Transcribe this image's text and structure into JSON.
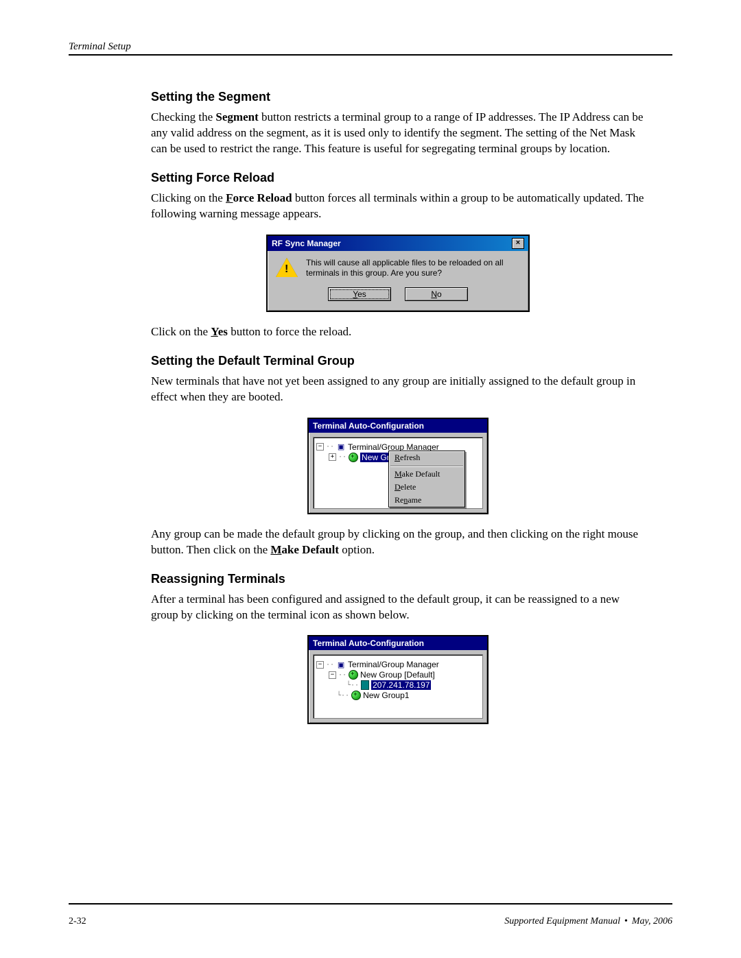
{
  "header": {
    "section": "Terminal Setup"
  },
  "sections": {
    "segment": {
      "heading": "Setting the Segment",
      "para1_a": "Checking the ",
      "para1_bold": "Segment",
      "para1_b": " button restricts a terminal group to a range of IP addresses. The IP Address can be any valid address on the segment, as it is used only to identify the segment. The setting of the Net Mask can be used to restrict the range.  This feature is useful for segregating terminal groups by location."
    },
    "force_reload": {
      "heading": "Setting Force Reload",
      "para1_a": "Clicking on the ",
      "para1_bold": "Force Reload",
      "para1_b": " button forces all terminals within a group to be automatically updated. The following warning message appears.",
      "dialog": {
        "title": "RF Sync Manager",
        "message": "This will cause all applicable files to be reloaded on all terminals in this group.  Are you sure?",
        "yes": "Yes",
        "no": "No"
      },
      "para2_a": "Click on the ",
      "para2_bold": "Yes",
      "para2_b": " button to force the reload."
    },
    "default_group": {
      "heading": "Setting the Default Terminal Group",
      "para1": "New terminals that have not yet been assigned to any group are initially assigned to the default group in effect when they are booted.",
      "tree": {
        "title": "Terminal Auto-Configuration",
        "root": "Terminal/Group Manager",
        "group_selected": "New Group [Default]",
        "menu": {
          "refresh": "Refresh",
          "make_default": "Make Default",
          "delete": "Delete",
          "rename": "Rename"
        }
      },
      "para2_a": "Any group can be made the default group by clicking on the group, and then clicking on the right mouse button. Then click on the ",
      "para2_bold": "Make Default",
      "para2_b": " option."
    },
    "reassign": {
      "heading": "Reassigning Terminals",
      "para1": "After a terminal has been configured and assigned to the default group, it can be reassigned to a new group by clicking on the terminal icon as shown below.",
      "tree": {
        "title": "Terminal Auto-Configuration",
        "root": "Terminal/Group Manager",
        "group1": "New Group [Default]",
        "terminal_selected": "207.241.78.197",
        "group2": "New Group1"
      }
    }
  },
  "footer": {
    "page_num": "2-32",
    "manual": "Supported Equipment Manual",
    "date": "May, 2006"
  }
}
